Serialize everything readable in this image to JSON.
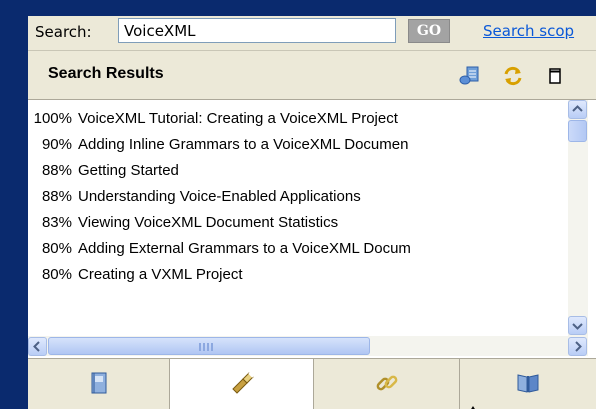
{
  "search": {
    "label": "Search:",
    "value": "VoiceXML",
    "go_label": "GO",
    "scope_link": "Search scop"
  },
  "panel": {
    "title": "Search Results"
  },
  "results": [
    {
      "score": "100%",
      "title": "VoiceXML Tutorial: Creating a VoiceXML Project"
    },
    {
      "score": "90%",
      "title": "Adding Inline Grammars to a VoiceXML Documen"
    },
    {
      "score": "88%",
      "title": "Getting Started"
    },
    {
      "score": "88%",
      "title": "Understanding Voice-Enabled Applications"
    },
    {
      "score": "83%",
      "title": "Viewing VoiceXML Document Statistics"
    },
    {
      "score": "80%",
      "title": "Adding External Grammars to a VoiceXML Docum"
    },
    {
      "score": "80%",
      "title": "Creating a VXML Project"
    }
  ],
  "tabs": [
    {
      "icon": "contents-icon",
      "active": false
    },
    {
      "icon": "search-flashlight-icon",
      "active": true
    },
    {
      "icon": "links-icon",
      "active": false
    },
    {
      "icon": "bookmarks-book-icon",
      "active": false
    }
  ],
  "colors": {
    "background": "#0a2a6e",
    "link": "#0a58d8",
    "go_button": "#a3a3a3"
  }
}
